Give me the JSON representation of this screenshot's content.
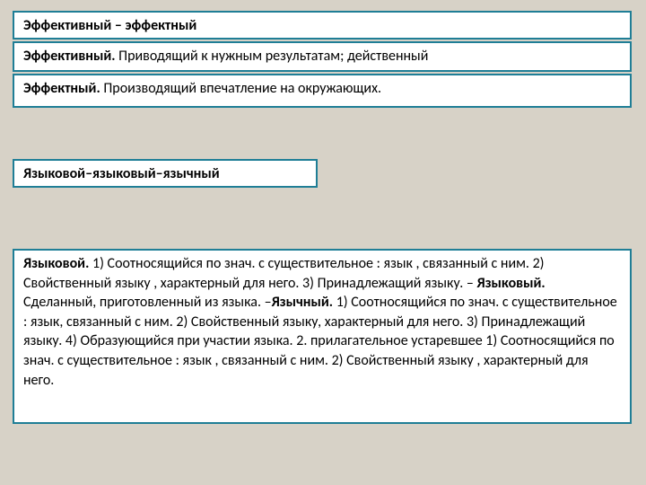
{
  "box1": {
    "text": "Эффективный – эффектный"
  },
  "box2": {
    "b": "Эффективный.",
    "t": "  Приводящий к нужным результатам; действенный"
  },
  "box3": {
    "b": "Эффектный.",
    "t": " Производящий впечатление на окружающих."
  },
  "box4": {
    "text": "Языковой–языковый–язычный"
  },
  "box5": {
    "p1b": "Языковой.",
    "p1": " 1) Соотносящийся по знач. с существительное : язык , связанный с ним. 2) Свойственный языку , характерный для него. 3) Принадлежащий языку. – ",
    "p2b": "Языковый.",
    "p2": " Сделанный, приготовленный из языка. –",
    "p3b": "Язычный.",
    "p3": "  1) Соотносящийся по знач. с существительное : язык, связанный с ним. 2) Свойственный языку, характерный для него. 3) Принадлежащий языку. 4) Образующийся при участии языка. 2. прилагательное устаревшее 1) Соотносящийся по знач. с существительное : язык , связанный с ним. 2) Свойственный языку , характерный для него."
  }
}
